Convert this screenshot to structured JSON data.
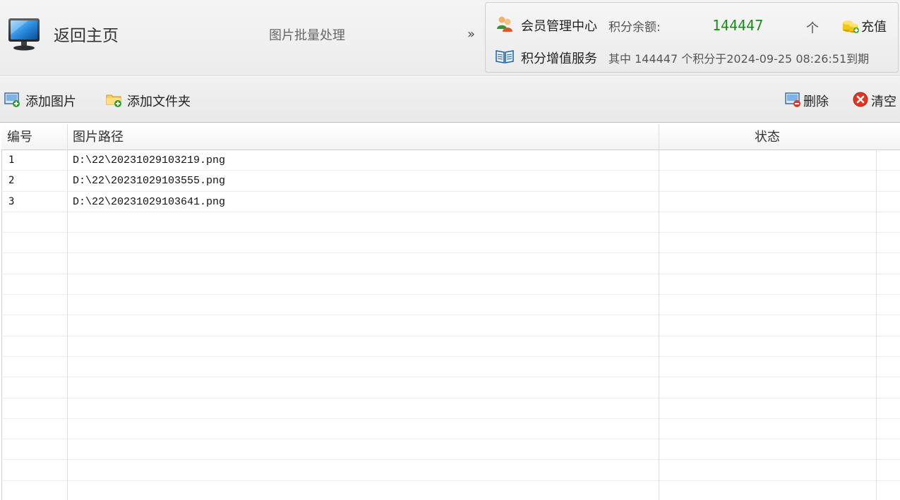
{
  "header": {
    "home_label": "返回主页",
    "page_title": "图片批量处理",
    "expand_glyph": "»"
  },
  "account": {
    "member_center": "会员管理中心",
    "balance_label": "积分余额:",
    "balance_value": "144447",
    "unit": "个",
    "recharge_label": "充值",
    "value_service": "积分增值服务",
    "expire_text": "其中 144447 个积分于2024-09-25 08:26:51到期",
    "balance_color": "#1a8c1a"
  },
  "toolbar": {
    "add_image": "添加图片",
    "add_folder": "添加文件夹",
    "delete": "删除",
    "clear": "清空"
  },
  "table": {
    "columns": [
      "编号",
      "图片路径",
      "状态"
    ],
    "rows": [
      {
        "idx": "1",
        "path": "D:\\22\\20231029103219.png",
        "status": ""
      },
      {
        "idx": "2",
        "path": "D:\\22\\20231029103555.png",
        "status": ""
      },
      {
        "idx": "3",
        "path": "D:\\22\\20231029103641.png",
        "status": ""
      },
      {
        "idx": "",
        "path": "",
        "status": ""
      },
      {
        "idx": "",
        "path": "",
        "status": ""
      },
      {
        "idx": "",
        "path": "",
        "status": ""
      },
      {
        "idx": "",
        "path": "",
        "status": ""
      },
      {
        "idx": "",
        "path": "",
        "status": ""
      },
      {
        "idx": "",
        "path": "",
        "status": ""
      },
      {
        "idx": "",
        "path": "",
        "status": ""
      },
      {
        "idx": "",
        "path": "",
        "status": ""
      },
      {
        "idx": "",
        "path": "",
        "status": ""
      },
      {
        "idx": "",
        "path": "",
        "status": ""
      },
      {
        "idx": "",
        "path": "",
        "status": ""
      },
      {
        "idx": "",
        "path": "",
        "status": ""
      },
      {
        "idx": "",
        "path": "",
        "status": ""
      },
      {
        "idx": "",
        "path": "",
        "status": ""
      }
    ]
  },
  "icons": {
    "home": "monitor-icon",
    "member": "users-icon",
    "service": "book-icon",
    "recharge": "coins-icon",
    "add_image": "add-image-icon",
    "add_folder": "add-folder-icon",
    "delete": "delete-icon",
    "clear": "clear-icon"
  }
}
